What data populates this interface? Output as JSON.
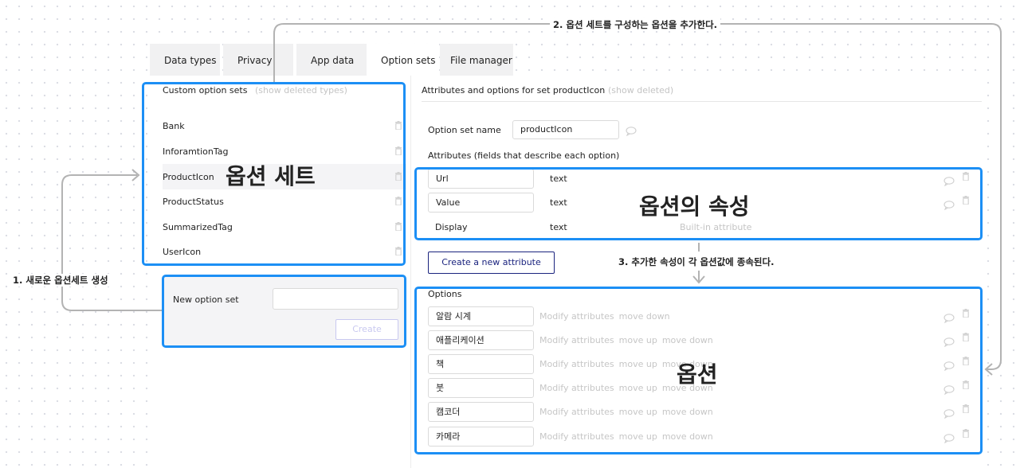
{
  "tabs": [
    {
      "label": "Data types"
    },
    {
      "label": "Privacy"
    },
    {
      "label": "App data"
    },
    {
      "label": "Option sets"
    },
    {
      "label": "File manager"
    }
  ],
  "left": {
    "header": "Custom option sets",
    "show_deleted": "(show deleted types)",
    "items": [
      {
        "label": "Bank"
      },
      {
        "label": "InforamtionTag"
      },
      {
        "label": "ProductIcon"
      },
      {
        "label": "ProductStatus"
      },
      {
        "label": "SummarizedTag"
      },
      {
        "label": "UserIcon"
      }
    ],
    "new_label": "New option set",
    "new_value": "",
    "create_label": "Create"
  },
  "right": {
    "header": "Attributes and options for set productIcon",
    "show_deleted": "(show deleted)",
    "name_label": "Option set name",
    "name_value": "productIcon",
    "attributes_label": "Attributes (fields that describe each option)",
    "attributes": [
      {
        "name": "Url",
        "type": "text",
        "note": ""
      },
      {
        "name": "Value",
        "type": "text",
        "note": ""
      },
      {
        "name": "Display",
        "type": "text",
        "note": "Built-in attribute"
      }
    ],
    "create_attr_label": "Create a new attribute",
    "options_label": "Options",
    "options": [
      {
        "name": "알람 시계"
      },
      {
        "name": "애플리케이션"
      },
      {
        "name": "책"
      },
      {
        "name": "붓"
      },
      {
        "name": "캠코더"
      },
      {
        "name": "카메라"
      }
    ],
    "link_modify": "Modify attributes",
    "link_up": "move up",
    "link_down": "move down"
  },
  "annotations": {
    "big_sets": "옵션 세트",
    "big_attrs": "옵션의 속성",
    "big_options": "옵션",
    "note1": "1. 새로운 옵션세트 생성",
    "note2": "2. 옵션 세트를 구성하는 옵션을 추가한다.",
    "note3": "3. 추가한 속성이 각 옵션값에 종속된다."
  },
  "colors": {
    "highlight": "#1c8ff5",
    "primary": "#1a237e",
    "arrow": "#b3b3b3"
  }
}
